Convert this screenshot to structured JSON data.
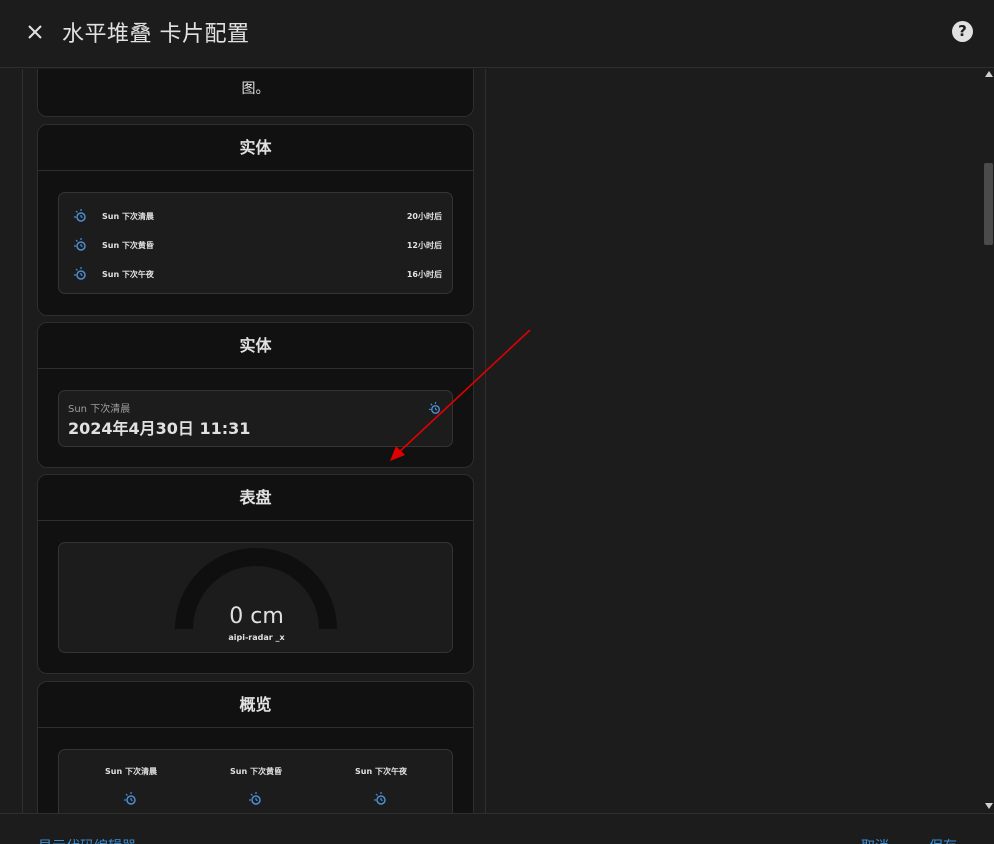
{
  "dialog": {
    "title": "水平堆叠 卡片配置"
  },
  "top_card": {
    "text_line_cut": " ",
    "text_line_2": "图。"
  },
  "entities_card": {
    "title": "实体",
    "rows": [
      {
        "name": "Sun 下次清晨",
        "value": "20小时后",
        "icon": "sun-clock-icon"
      },
      {
        "name": "Sun 下次黄昏",
        "value": "12小时后",
        "icon": "sun-clock-icon"
      },
      {
        "name": "Sun 下次午夜",
        "value": "16小时后",
        "icon": "sun-clock-icon"
      }
    ]
  },
  "entity_card": {
    "title": "实体",
    "name": "Sun 下次清晨",
    "value": "2024年4月30日 11:31",
    "icon": "sun-clock-icon"
  },
  "gauge_card": {
    "title": "表盘",
    "value": "0 cm",
    "name": "aipi-radar _x",
    "level": 0
  },
  "glance_card": {
    "title": "概览",
    "items": [
      {
        "name": "Sun 下次清晨",
        "icon": "sun-clock-icon"
      },
      {
        "name": "Sun 下次黄昏",
        "icon": "sun-clock-icon"
      },
      {
        "name": "Sun 下次午夜",
        "icon": "sun-clock-icon"
      }
    ]
  },
  "footer": {
    "code_editor_label": "显示代码编辑器",
    "cancel_label": "取消",
    "save_label": "保存"
  },
  "colors": {
    "background": "#1c1c1c",
    "card": "#111111",
    "accent": "#3a8fd9",
    "icon": "#4a8fd6",
    "annotation_arrow": "#e00000"
  }
}
